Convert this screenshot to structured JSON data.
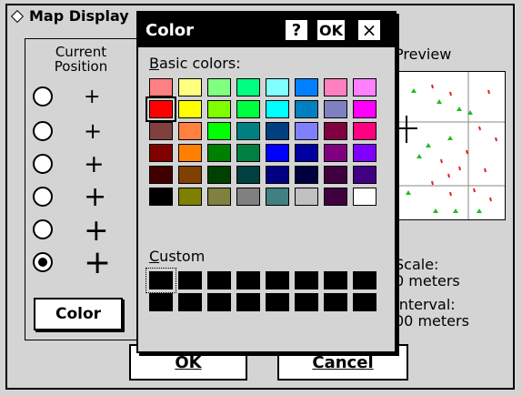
{
  "base_window": {
    "title": "Map Display",
    "current_position_label_line1": "Current",
    "current_position_label_line2": "Position",
    "color_button": "Color",
    "preview_label": "Preview",
    "scale_label": "Scale:",
    "scale_value": "0 meters",
    "interval_label": "Interval:",
    "interval_value": "00 meters",
    "ok_button": "OK",
    "cancel_button": "Cancel",
    "cross_glyph": "+"
  },
  "color_dialog": {
    "title": "Color",
    "help_button": "?",
    "ok_button": "OK",
    "close_button": "×",
    "basic_colors_label": "Basic colors:",
    "custom_label": "Custom",
    "basic_colors": [
      "#ff8080",
      "#ffff80",
      "#80ff80",
      "#00ff80",
      "#80ffff",
      "#0080ff",
      "#ff80c0",
      "#ff80ff",
      "#ff0000",
      "#ffff00",
      "#80ff00",
      "#00ff40",
      "#00ffff",
      "#0080c0",
      "#8080c0",
      "#ff00ff",
      "#804040",
      "#ff8040",
      "#00ff00",
      "#008080",
      "#004080",
      "#8080ff",
      "#800040",
      "#ff0080",
      "#800000",
      "#ff8000",
      "#008000",
      "#008040",
      "#0000ff",
      "#0000a0",
      "#800080",
      "#8000ff",
      "#400000",
      "#804000",
      "#004000",
      "#004040",
      "#000080",
      "#000040",
      "#400040",
      "#400080",
      "#000000",
      "#808000",
      "#808040",
      "#808080",
      "#408080",
      "#c0c0c0",
      "#400040",
      "#ffffff"
    ],
    "selected_basic_index": 8,
    "custom_colors": [
      "#000000",
      "#000000",
      "#000000",
      "#000000",
      "#000000",
      "#000000",
      "#000000",
      "#000000",
      "#000000",
      "#000000",
      "#000000",
      "#000000",
      "#000000",
      "#000000",
      "#000000",
      "#000000"
    ]
  }
}
